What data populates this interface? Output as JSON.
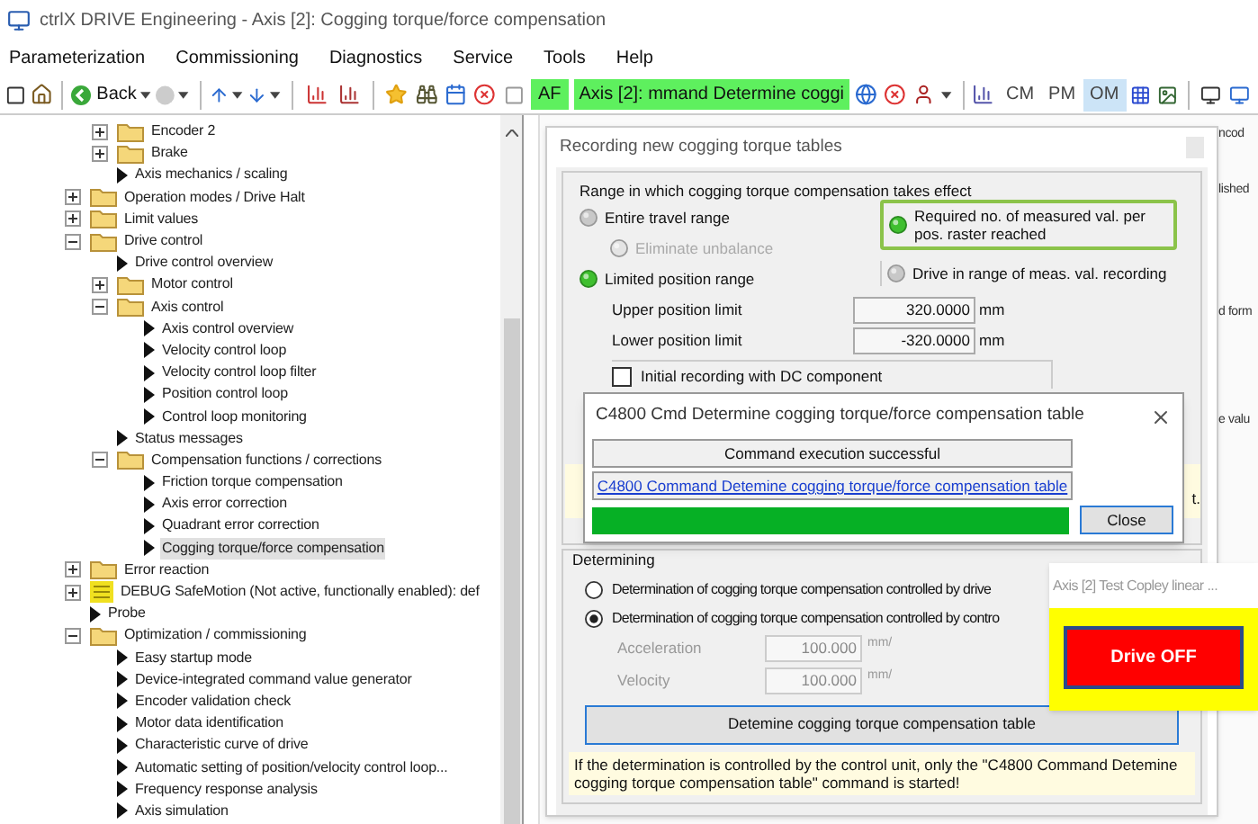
{
  "window": {
    "title": "ctrlX DRIVE Engineering - Axis [2]: Cogging torque/force compensation"
  },
  "menu": [
    "Parameterization",
    "Commissioning",
    "Diagnostics",
    "Service",
    "Tools",
    "Help"
  ],
  "toolbar": {
    "back": "Back",
    "status_af": "AF",
    "axis_status": "Axis [2]:  mmand Determine coggi",
    "modes": [
      {
        "label": "CM",
        "selected": false
      },
      {
        "label": "PM",
        "selected": false
      },
      {
        "label": "OM",
        "selected": true
      }
    ]
  },
  "tree": {
    "continued_branch": [
      {
        "kind": "folder",
        "label": "Encoder 2",
        "expanded": false,
        "selected": false
      },
      {
        "kind": "folder",
        "label": "Brake",
        "expanded": false,
        "selected": false
      },
      {
        "kind": "leaf",
        "label": "Axis mechanics / scaling",
        "selected": false
      }
    ],
    "items": [
      {
        "kind": "folder",
        "label": "Operation modes / Drive Halt",
        "expanded": false,
        "selected": false
      },
      {
        "kind": "folder",
        "label": "Limit values",
        "expanded": false,
        "selected": false
      },
      {
        "kind": "folder",
        "label": "Drive control",
        "expanded": true,
        "selected": false,
        "children": [
          {
            "kind": "leaf",
            "label": "Drive control overview",
            "selected": false
          },
          {
            "kind": "folder",
            "label": "Motor control",
            "expanded": false,
            "selected": false
          },
          {
            "kind": "folder",
            "label": "Axis control",
            "expanded": true,
            "selected": false,
            "children": [
              {
                "kind": "leaf",
                "label": "Axis control overview",
                "selected": false
              },
              {
                "kind": "leaf",
                "label": "Velocity control loop",
                "selected": false
              },
              {
                "kind": "leaf",
                "label": "Velocity control loop filter",
                "selected": false
              },
              {
                "kind": "leaf",
                "label": "Position control loop",
                "selected": false
              },
              {
                "kind": "leaf",
                "label": "Control loop monitoring",
                "selected": false
              }
            ]
          },
          {
            "kind": "leaf",
            "label": "Status messages",
            "selected": false
          },
          {
            "kind": "folder",
            "label": "Compensation functions / corrections",
            "expanded": true,
            "selected": false,
            "children": [
              {
                "kind": "leaf",
                "label": "Friction torque compensation",
                "selected": false
              },
              {
                "kind": "leaf",
                "label": "Axis error correction",
                "selected": false
              },
              {
                "kind": "leaf",
                "label": "Quadrant error correction",
                "selected": false
              },
              {
                "kind": "leaf",
                "label": "Cogging torque/force compensation",
                "selected": true
              }
            ]
          }
        ]
      },
      {
        "kind": "folder",
        "label": "Error reaction",
        "expanded": false,
        "selected": false
      },
      {
        "kind": "debug",
        "label": "DEBUG SafeMotion (Not active, functionally enabled): def",
        "expanded": false,
        "selected": false
      },
      {
        "kind": "leaf",
        "label": "Probe",
        "selected": false
      },
      {
        "kind": "folder",
        "label": "Optimization / commissioning",
        "expanded": true,
        "selected": false,
        "children": [
          {
            "kind": "leaf",
            "label": "Easy startup mode",
            "selected": false
          },
          {
            "kind": "leaf",
            "label": "Device-integrated command value generator",
            "selected": false
          },
          {
            "kind": "leaf",
            "label": "Encoder validation check",
            "selected": false
          },
          {
            "kind": "leaf",
            "label": "Motor data identification",
            "selected": false
          },
          {
            "kind": "leaf",
            "label": "Characteristic curve of drive",
            "selected": false
          },
          {
            "kind": "leaf",
            "label": "Automatic setting of position/velocity control loop...",
            "selected": false
          },
          {
            "kind": "leaf",
            "label": "Frequency response analysis",
            "selected": false
          },
          {
            "kind": "leaf",
            "label": "Axis simulation",
            "selected": false
          }
        ]
      }
    ]
  },
  "background_window": {
    "fragments": [
      "ncod",
      "lished",
      "d form",
      "e valu"
    ]
  },
  "recording_window": {
    "title": "Recording new cogging torque tables",
    "range_group": {
      "label": "Range in which cogging torque compensation takes effect",
      "options": [
        {
          "label": "Entire travel range",
          "selected": false,
          "disabled": false
        },
        {
          "label": "Eliminate unbalance",
          "selected": false,
          "disabled": true
        },
        {
          "label": "Limited position range",
          "selected": true,
          "disabled": false
        }
      ],
      "fields": [
        {
          "label": "Upper position limit",
          "value": "320.0000",
          "unit": "mm"
        },
        {
          "label": "Lower position limit",
          "value": "-320.0000",
          "unit": "mm"
        }
      ],
      "checkbox": {
        "label": "Initial recording with DC component",
        "checked": false
      },
      "indicators": [
        {
          "label": "Required no. of measured val. per pos. raster reached",
          "on": true,
          "highlighted": true
        },
        {
          "label": "Drive in range of meas. val. recording",
          "on": false,
          "highlighted": false
        }
      ],
      "note_fragment": "t."
    },
    "determining_group": {
      "label": "Determining",
      "options": [
        {
          "label": "Determination of cogging torque compensation controlled by drive",
          "selected": false
        },
        {
          "label": "Determination of cogging torque compensation controlled by contro",
          "selected": true
        }
      ],
      "fields": [
        {
          "label": "Acceleration",
          "value": "100.000",
          "unit": "mm/",
          "disabled": true
        },
        {
          "label": "Velocity",
          "value": "100.000",
          "unit": "mm/",
          "disabled": true
        }
      ],
      "button": "Detemine cogging torque compensation table",
      "note": "If the determination is controlled by the control unit, only the \"C4800 Command Detemine cogging torque compensation table\" command is started!"
    }
  },
  "command_dialog": {
    "title": "C4800 Cmd Determine cogging torque/force compensation table",
    "status": "Command execution successful",
    "link": "C4800 Command Detemine cogging torque/force compensation table",
    "progress": {
      "level": 1.0
    },
    "close_button": "Close"
  },
  "drive_panel": {
    "title": "Axis [2] Test Copley linear ...",
    "button": "Drive OFF"
  }
}
